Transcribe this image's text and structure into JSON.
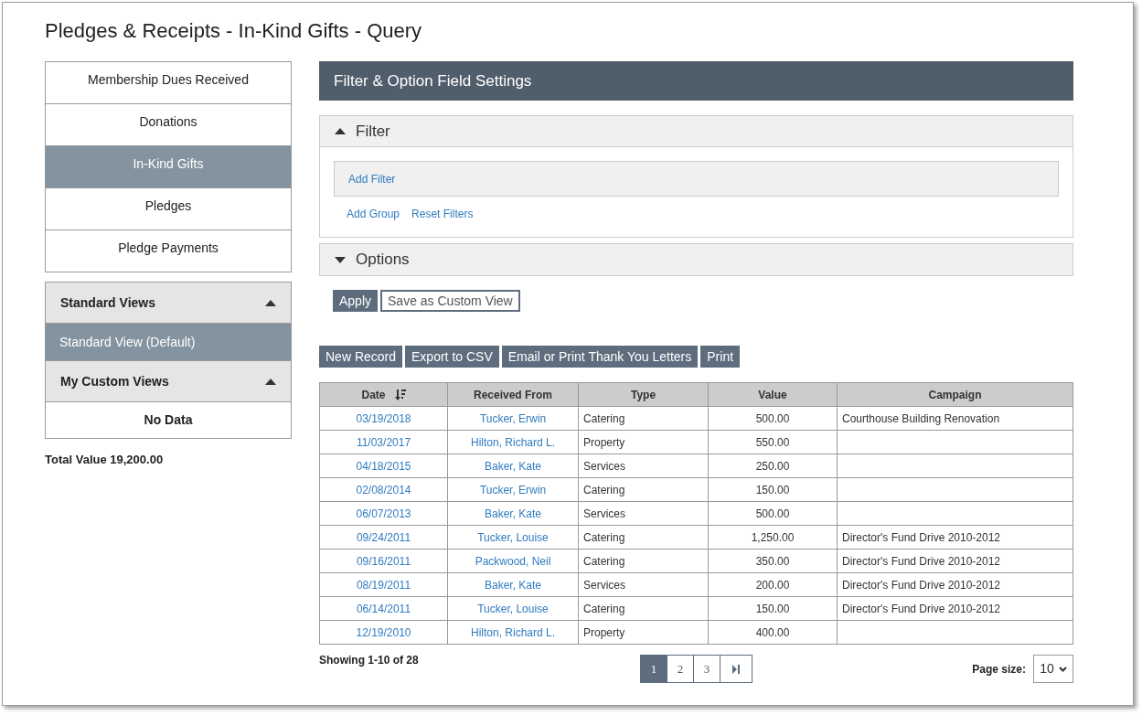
{
  "page_title": "Pledges & Receipts - In-Kind Gifts - Query",
  "nav": [
    {
      "label": "Membership Dues Received",
      "selected": false
    },
    {
      "label": "Donations",
      "selected": false
    },
    {
      "label": "In-Kind Gifts",
      "selected": true
    },
    {
      "label": "Pledges",
      "selected": false
    },
    {
      "label": "Pledge Payments",
      "selected": false
    }
  ],
  "views": [
    {
      "title": "Standard Views",
      "expanded": true,
      "items": [
        {
          "label": "Standard View (Default)",
          "selected": true
        }
      ]
    },
    {
      "title": "My Custom Views",
      "expanded": true,
      "empty_text": "No Data"
    }
  ],
  "total": "Total Value 19,200.00",
  "settings": {
    "title": "Filter & Option Field Settings",
    "filter": {
      "title": "Filter",
      "expanded": true,
      "add_filter": "Add Filter",
      "links": [
        "Add Group",
        "Reset Filters"
      ]
    },
    "options": {
      "title": "Options",
      "expanded": false
    },
    "buttons": [
      {
        "label": "Apply",
        "kind": "primary"
      },
      {
        "label": "Save as Custom View",
        "kind": "outline"
      }
    ]
  },
  "toolbar": [
    "New Record",
    "Export to CSV",
    "Email or Print Thank You Letters",
    "Print"
  ],
  "table": {
    "columns": [
      {
        "label": "Date",
        "sorted": true
      },
      {
        "label": "Received From",
        "sorted": false
      },
      {
        "label": "Type",
        "sorted": false
      },
      {
        "label": "Value",
        "sorted": false
      },
      {
        "label": "Campaign",
        "sorted": false
      }
    ],
    "rows": [
      {
        "date": "03/19/2018",
        "from": "Tucker, Erwin",
        "type": "Catering",
        "value": "500.00",
        "campaign": "Courthouse Building Renovation"
      },
      {
        "date": "11/03/2017",
        "from": "Hilton, Richard L.",
        "type": "Property",
        "value": "550.00"
      },
      {
        "date": "04/18/2015",
        "from": "Baker, Kate",
        "type": "Services",
        "value": "250.00"
      },
      {
        "date": "02/08/2014",
        "from": "Tucker, Erwin",
        "type": "Catering",
        "value": "150.00"
      },
      {
        "date": "06/07/2013",
        "from": "Baker, Kate",
        "type": "Services",
        "value": "500.00"
      },
      {
        "date": "09/24/2011",
        "from": "Tucker, Louise",
        "type": "Catering",
        "value": "1,250.00",
        "campaign": "Director's Fund Drive 2010-2012"
      },
      {
        "date": "09/16/2011",
        "from": "Packwood, Neil",
        "type": "Catering",
        "value": "350.00",
        "campaign": "Director's Fund Drive 2010-2012"
      },
      {
        "date": "08/19/2011",
        "from": "Baker, Kate",
        "type": "Services",
        "value": "200.00",
        "campaign": "Director's Fund Drive 2010-2012"
      },
      {
        "date": "06/14/2011",
        "from": "Tucker, Louise",
        "type": "Catering",
        "value": "150.00",
        "campaign": "Director's Fund Drive 2010-2012"
      },
      {
        "date": "12/19/2010",
        "from": "Hilton, Richard L.",
        "type": "Property",
        "value": "400.00"
      }
    ]
  },
  "footer": {
    "showing": "Showing 1-10 of 28",
    "pages": [
      {
        "label": "1",
        "selected": true
      },
      {
        "label": "2",
        "selected": false
      },
      {
        "label": "3",
        "selected": false
      }
    ],
    "page_size_label": "Page size:",
    "page_size": "10"
  }
}
